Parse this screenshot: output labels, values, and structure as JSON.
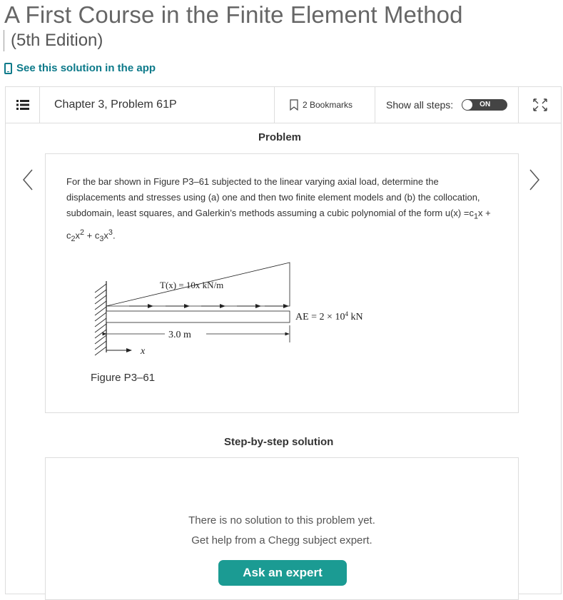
{
  "book": {
    "title": "A First Course in the Finite Element Method",
    "edition": "(5th Edition)"
  },
  "app_link": {
    "label": "See this solution in the app"
  },
  "toolbar": {
    "chapter_label": "Chapter 3, Problem 61P",
    "bookmarks_label": "2 Bookmarks",
    "show_steps_label": "Show all steps:",
    "toggle_state": "ON"
  },
  "problem": {
    "heading": "Problem",
    "text_before": "For the bar shown in Figure P3–61 subjected to the linear varying axial load, determine the displacements and stresses using (a) one and then two finite element models and (b) the collocation, subdomain, least squares, and Galerkin’s methods assuming a cubic polynomial of the form u(x) =c",
    "figure": {
      "load_label": "T(x) = 10x kN/m",
      "ae_label": "AE = 2 × 10",
      "ae_exp": "4",
      "ae_unit": " kN",
      "length_label": "3.0 m",
      "axis_label": "x",
      "caption": "Figure P3–61"
    }
  },
  "solution": {
    "heading": "Step-by-step solution",
    "no_solution_line1": "There is no solution to this problem yet.",
    "no_solution_line2": "Get help from a Chegg subject expert.",
    "ask_button": "Ask an expert"
  },
  "colors": {
    "accent": "#0d7a8a",
    "button": "#1b9b93"
  }
}
